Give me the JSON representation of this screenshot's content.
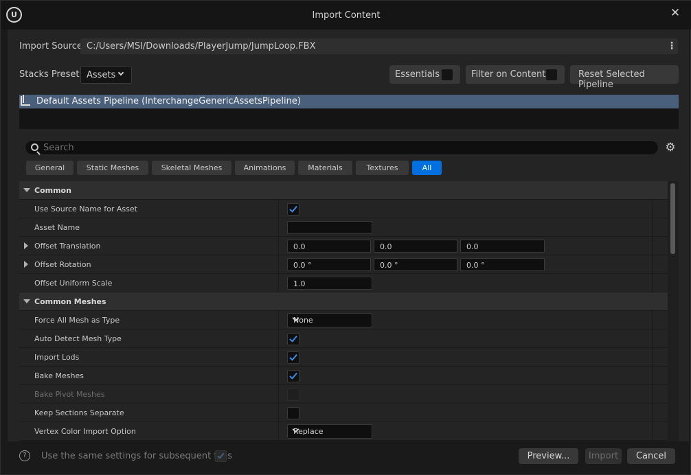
{
  "window": {
    "title": "Import Content"
  },
  "import_source": {
    "label": "Import Source",
    "path": "C:/Users/MSI/Downloads/PlayerJump/JumpLoop.FBX"
  },
  "stacks_preset": {
    "label": "Stacks Preset",
    "value": "Assets"
  },
  "toolbar": {
    "essentials": "Essentials",
    "filter_on_contents": "Filter on Contents",
    "reset_selected_pipeline": "Reset Selected Pipeline"
  },
  "pipeline": {
    "name": "Default Assets Pipeline (InterchangeGenericAssetsPipeline)"
  },
  "search": {
    "placeholder": "Search"
  },
  "tabs": [
    "General",
    "Static Meshes",
    "Skeletal Meshes",
    "Animations",
    "Materials",
    "Textures",
    "All"
  ],
  "active_tab": "All",
  "sections": {
    "common": {
      "label": "Common",
      "use_source_name": {
        "label": "Use Source Name for Asset",
        "checked": true
      },
      "asset_name": {
        "label": "Asset Name",
        "value": ""
      },
      "offset_translation": {
        "label": "Offset Translation",
        "x": "0.0",
        "y": "0.0",
        "z": "0.0"
      },
      "offset_rotation": {
        "label": "Offset Rotation",
        "x": "0.0 °",
        "y": "0.0 °",
        "z": "0.0 °"
      },
      "offset_uniform_scale": {
        "label": "Offset Uniform Scale",
        "value": "1.0"
      }
    },
    "common_meshes": {
      "label": "Common Meshes",
      "force_all_mesh_as_type": {
        "label": "Force All Mesh as Type",
        "value": "None"
      },
      "auto_detect_mesh_type": {
        "label": "Auto Detect Mesh Type",
        "checked": true
      },
      "import_lods": {
        "label": "Import Lods",
        "checked": true
      },
      "bake_meshes": {
        "label": "Bake Meshes",
        "checked": true
      },
      "bake_pivot_meshes": {
        "label": "Bake Pivot Meshes",
        "checked": false,
        "disabled": true
      },
      "keep_sections_separate": {
        "label": "Keep Sections Separate",
        "checked": false
      },
      "vertex_color_import_option": {
        "label": "Vertex Color Import Option",
        "value": "Replace"
      }
    }
  },
  "footer": {
    "same_settings_label": "Use the same settings for subsequent files",
    "same_settings_checked": true,
    "preview": "Preview...",
    "import": "Import",
    "cancel": "Cancel"
  }
}
